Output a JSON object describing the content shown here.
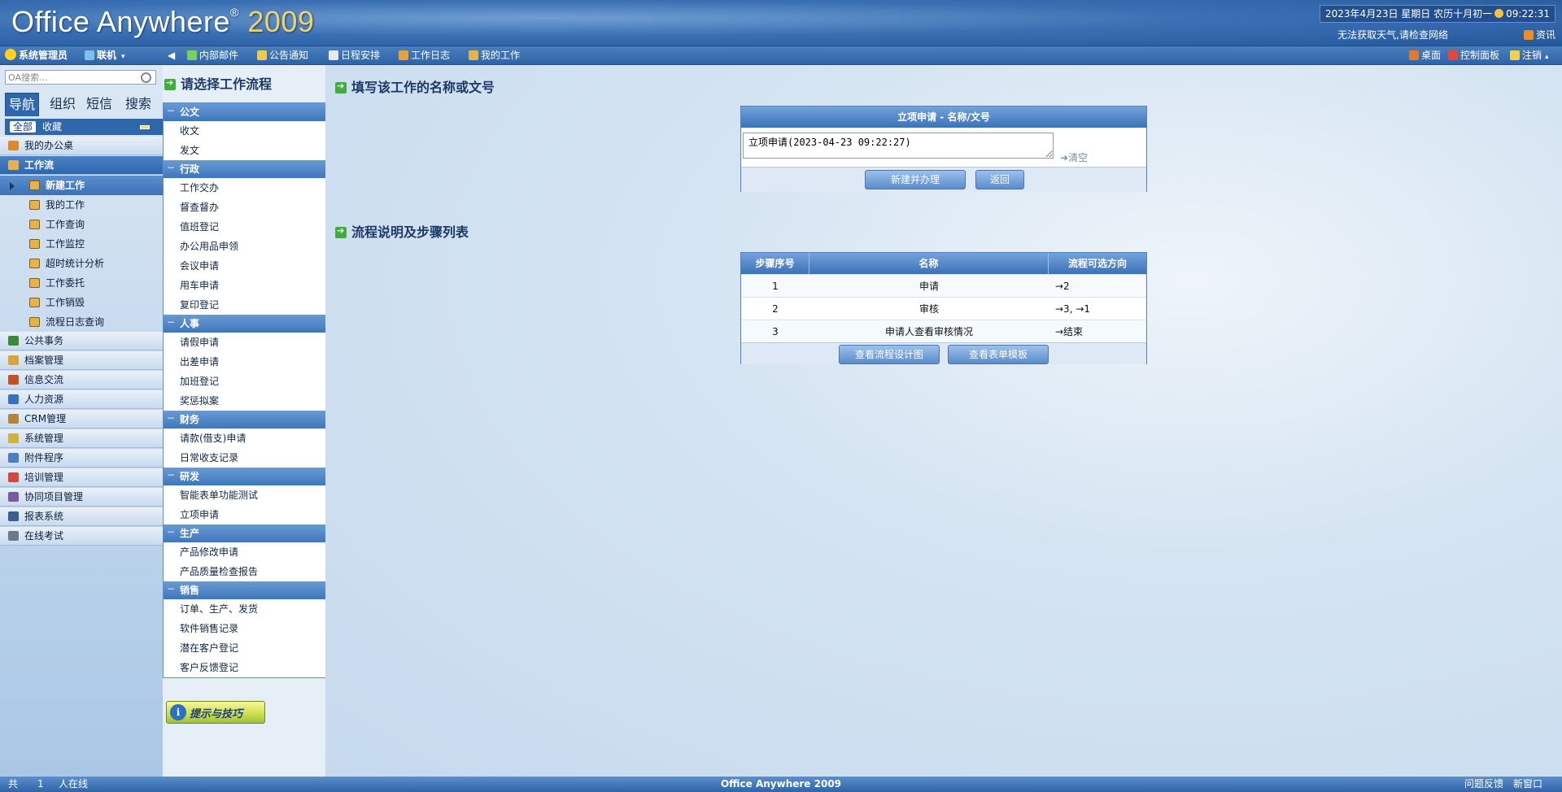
{
  "header": {
    "logo_text": "Office Anywhere",
    "logo_reg": "®",
    "logo_year": "2009",
    "datetime": "2023年4月23日 星期日 农历十月初一",
    "clock": "09:22:31",
    "weather": "无法获取天气,请检查网络",
    "news": "资讯"
  },
  "toolbar": {
    "user": "系统管理员",
    "online": "联机",
    "items": [
      "内部邮件",
      "公告通知",
      "日程安排",
      "工作日志",
      "我的工作"
    ],
    "desktop": "桌面",
    "control_panel": "控制面板",
    "logout": "注销"
  },
  "sidebar": {
    "search_placeholder": "OA搜索...",
    "tabs": [
      "导航",
      "组织",
      "短信",
      "搜索"
    ],
    "subtab_all": "全部",
    "subtab_fav": "收藏",
    "items": [
      {
        "label": "我的办公桌",
        "color": "#d98b2b"
      },
      {
        "label": "工作流",
        "color": "#e4b34a"
      },
      {
        "label": "公共事务",
        "color": "#3a8a3a"
      },
      {
        "label": "档案管理",
        "color": "#d9a53a"
      },
      {
        "label": "信息交流",
        "color": "#c2521f"
      },
      {
        "label": "人力资源",
        "color": "#3b6fc0"
      },
      {
        "label": "CRM管理",
        "color": "#b5833b"
      },
      {
        "label": "系统管理",
        "color": "#d1b23d"
      },
      {
        "label": "附件程序",
        "color": "#4a7fc4"
      },
      {
        "label": "培训管理",
        "color": "#d04a3a"
      },
      {
        "label": "协同项目管理",
        "color": "#7a5a9e"
      },
      {
        "label": "报表系统",
        "color": "#3a5f8e"
      },
      {
        "label": "在线考试",
        "color": "#6a7a8e"
      }
    ],
    "workflow_sub": [
      "新建工作",
      "我的工作",
      "工作查询",
      "工作监控",
      "超时统计分析",
      "工作委托",
      "工作销毁",
      "流程日志查询"
    ]
  },
  "flow_panel": {
    "title": "请选择工作流程",
    "categories": [
      {
        "name": "公文",
        "flows": [
          "收文",
          "发文"
        ]
      },
      {
        "name": "行政",
        "flows": [
          "工作交办",
          "督查督办",
          "值班登记",
          "办公用品申领",
          "会议申请",
          "用车申请",
          "复印登记"
        ]
      },
      {
        "name": "人事",
        "flows": [
          "请假申请",
          "出差申请",
          "加班登记",
          "奖惩拟案"
        ]
      },
      {
        "name": "财务",
        "flows": [
          "请款(借支)申请",
          "日常收支记录"
        ]
      },
      {
        "name": "研发",
        "flows": [
          "智能表单功能测试",
          "立项申请"
        ]
      },
      {
        "name": "生产",
        "flows": [
          "产品修改申请",
          "产品质量检查报告"
        ]
      },
      {
        "name": "销售",
        "flows": [
          "订单、生产、发货",
          "软件销售记录",
          "潜在客户登记",
          "客户反馈登记"
        ]
      }
    ],
    "tips": "提示与技巧"
  },
  "main": {
    "name_section_title": "填写该工作的名称或文号",
    "name_box_header": "立项申请 - 名称/文号",
    "name_value": "立项申请(2023-04-23 09:22:27)",
    "clear_label": "清空",
    "create_button": "新建并办理",
    "back_button": "返回",
    "steps_section_title": "流程说明及步骤列表",
    "steps_headers": [
      "步骤序号",
      "名称",
      "流程可选方向"
    ],
    "steps": [
      {
        "no": "1",
        "name": "申请",
        "dir": "→2"
      },
      {
        "no": "2",
        "name": "审核",
        "dir": "→3, →1"
      },
      {
        "no": "3",
        "name": "申请人查看审核情况",
        "dir": "→结束"
      }
    ],
    "view_design_button": "查看流程设计图",
    "view_form_button": "查看表单模板"
  },
  "status": {
    "online_prefix": "共",
    "online_count": "1",
    "online_suffix": "人在线",
    "center": "Office Anywhere 2009",
    "feedback": "问题反馈",
    "new_window": "新窗口"
  }
}
